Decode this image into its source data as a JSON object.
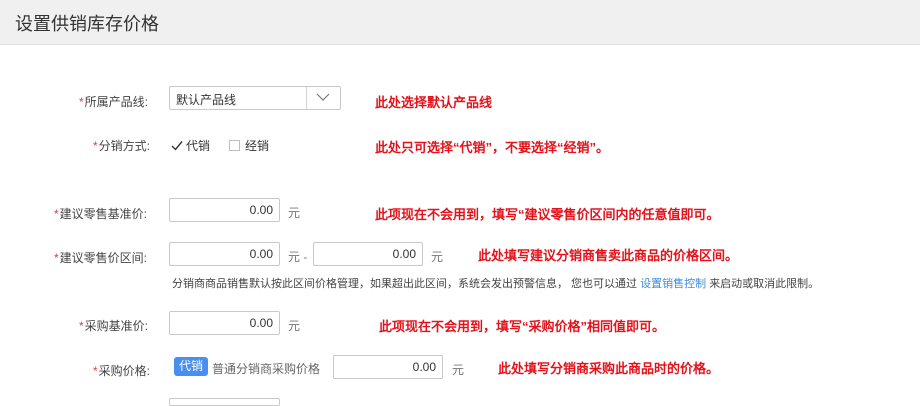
{
  "page": {
    "title": "设置供销库存价格"
  },
  "product_line": {
    "label": "所属产品线:",
    "value": "默认产品线",
    "note": "此处选择默认产品线"
  },
  "distribution": {
    "label": "分销方式:",
    "option_consign": "代销",
    "option_consign_checked": true,
    "option_wholesale": "经销",
    "option_wholesale_checked": false,
    "note": "此处只可选择“代销”，不要选择“经销”。"
  },
  "retail_base": {
    "label": "建议零售基准价:",
    "value": "0.00",
    "unit": "元",
    "note": "此项现在不会用到，填写“建议零售价区间内的任意值即可。"
  },
  "retail_range": {
    "label": "建议零售价区间:",
    "min": "0.00",
    "unit_min": "元 -",
    "max": "0.00",
    "unit_max": "元",
    "note": "此处填写建议分销商售卖此商品的价格区间。",
    "hint_text": "分销商商品销售默认按此区间价格管理，如果超出此区间，系统会发出预警信息，  您也可以通过",
    "hint_link": "设置销售控制",
    "hint_suffix": "来启动或取消此限制。"
  },
  "purchase_base": {
    "label": "采购基准价:",
    "value": "0.00",
    "unit": "元",
    "note": "此项现在不会用到，填写“采购价格”相同值即可。"
  },
  "purchase_price": {
    "label": "采购价格:",
    "badge": "代销",
    "sub_label": "普通分销商采购价格",
    "value": "0.00",
    "unit": "元",
    "note": "此处填写分销商采购此商品时的价格。"
  },
  "colors": {
    "required": "#e4393c",
    "note": "#e4121b",
    "badge": "#4a8ef0",
    "link": "#3c8dde"
  }
}
